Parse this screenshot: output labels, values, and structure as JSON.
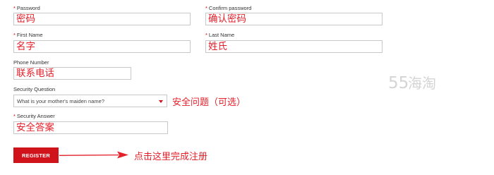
{
  "form": {
    "password": {
      "label": "Password",
      "required_mark": "*",
      "value": "密码"
    },
    "confirm_password": {
      "label": "Confirm password",
      "required_mark": "*",
      "value": "确认密码"
    },
    "first_name": {
      "label": "First Name",
      "required_mark": "*",
      "value": "名字"
    },
    "last_name": {
      "label": "Last Name",
      "required_mark": "*",
      "value": "姓氏"
    },
    "phone": {
      "label": "Phone Number",
      "value": "联系电话"
    },
    "security_question": {
      "label": "Security Question",
      "selected": "What is your mother's maiden name?"
    },
    "security_answer": {
      "label": "Security Answer",
      "required_mark": "*",
      "value": "安全答案"
    },
    "register_label": "REGISTER"
  },
  "annotations": {
    "security_question_note": "安全问题（可选）",
    "register_note": "点击这里完成注册"
  },
  "watermark": {
    "text": "55海淘"
  },
  "colors": {
    "accent": "#d0121b",
    "annotation": "#e4212b",
    "border": "#c8c8c8"
  }
}
